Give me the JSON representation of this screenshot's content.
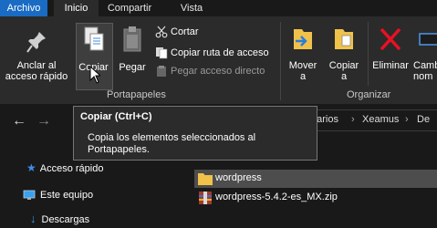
{
  "tabs": {
    "archivo": "Archivo",
    "inicio": "Inicio",
    "compartir": "Compartir",
    "vista": "Vista"
  },
  "ribbon": {
    "anclar_line1": "Anclar al",
    "anclar_line2": "acceso rápido",
    "copiar": "Copiar",
    "pegar": "Pegar",
    "cortar": "Cortar",
    "copiar_ruta": "Copiar ruta de acceso",
    "pegar_acceso": "Pegar acceso directo",
    "portapapeles": "Portapapeles",
    "mover_line1": "Mover",
    "mover_line2": "a",
    "copiar_a_line1": "Copiar",
    "copiar_a_line2": "a",
    "eliminar": "Eliminar",
    "cambiar_line1": "Camb",
    "cambiar_line2": "nom",
    "organizar": "Organizar"
  },
  "address": {
    "crumb1": "uarios",
    "crumb2": "Xeamus",
    "crumb3": "De"
  },
  "tooltip": {
    "title": "Copiar (Ctrl+C)",
    "body": "Copia los elementos seleccionados al Portapapeles."
  },
  "nav": {
    "acceso_rapido": "Acceso rápido",
    "este_equipo": "Este equipo",
    "descargas": "Descargas"
  },
  "files": [
    {
      "name": "wordpress",
      "type": "folder",
      "selected": true
    },
    {
      "name": "wordpress-5.4.2-es_MX.zip",
      "type": "zip",
      "selected": false
    }
  ],
  "colors": {
    "accent": "#1a6bc4",
    "ribbon_bg": "#2b2b2b",
    "window_bg": "#191919"
  }
}
